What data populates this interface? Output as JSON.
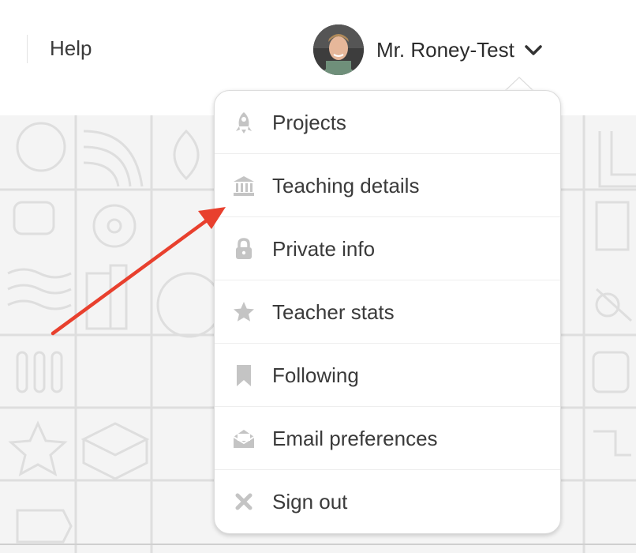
{
  "header": {
    "help_label": "Help",
    "user_name": "Mr. Roney-Test"
  },
  "menu": {
    "items": [
      {
        "label": "Projects",
        "icon": "rocket-icon"
      },
      {
        "label": "Teaching details",
        "icon": "bank-icon"
      },
      {
        "label": "Private info",
        "icon": "lock-icon"
      },
      {
        "label": "Teacher stats",
        "icon": "star-icon"
      },
      {
        "label": "Following",
        "icon": "bookmark-icon"
      },
      {
        "label": "Email preferences",
        "icon": "envelope-icon"
      },
      {
        "label": "Sign out",
        "icon": "close-icon"
      }
    ]
  },
  "colors": {
    "icon_gray": "#c4c4c4",
    "annotation_arrow": "#e8402e"
  }
}
